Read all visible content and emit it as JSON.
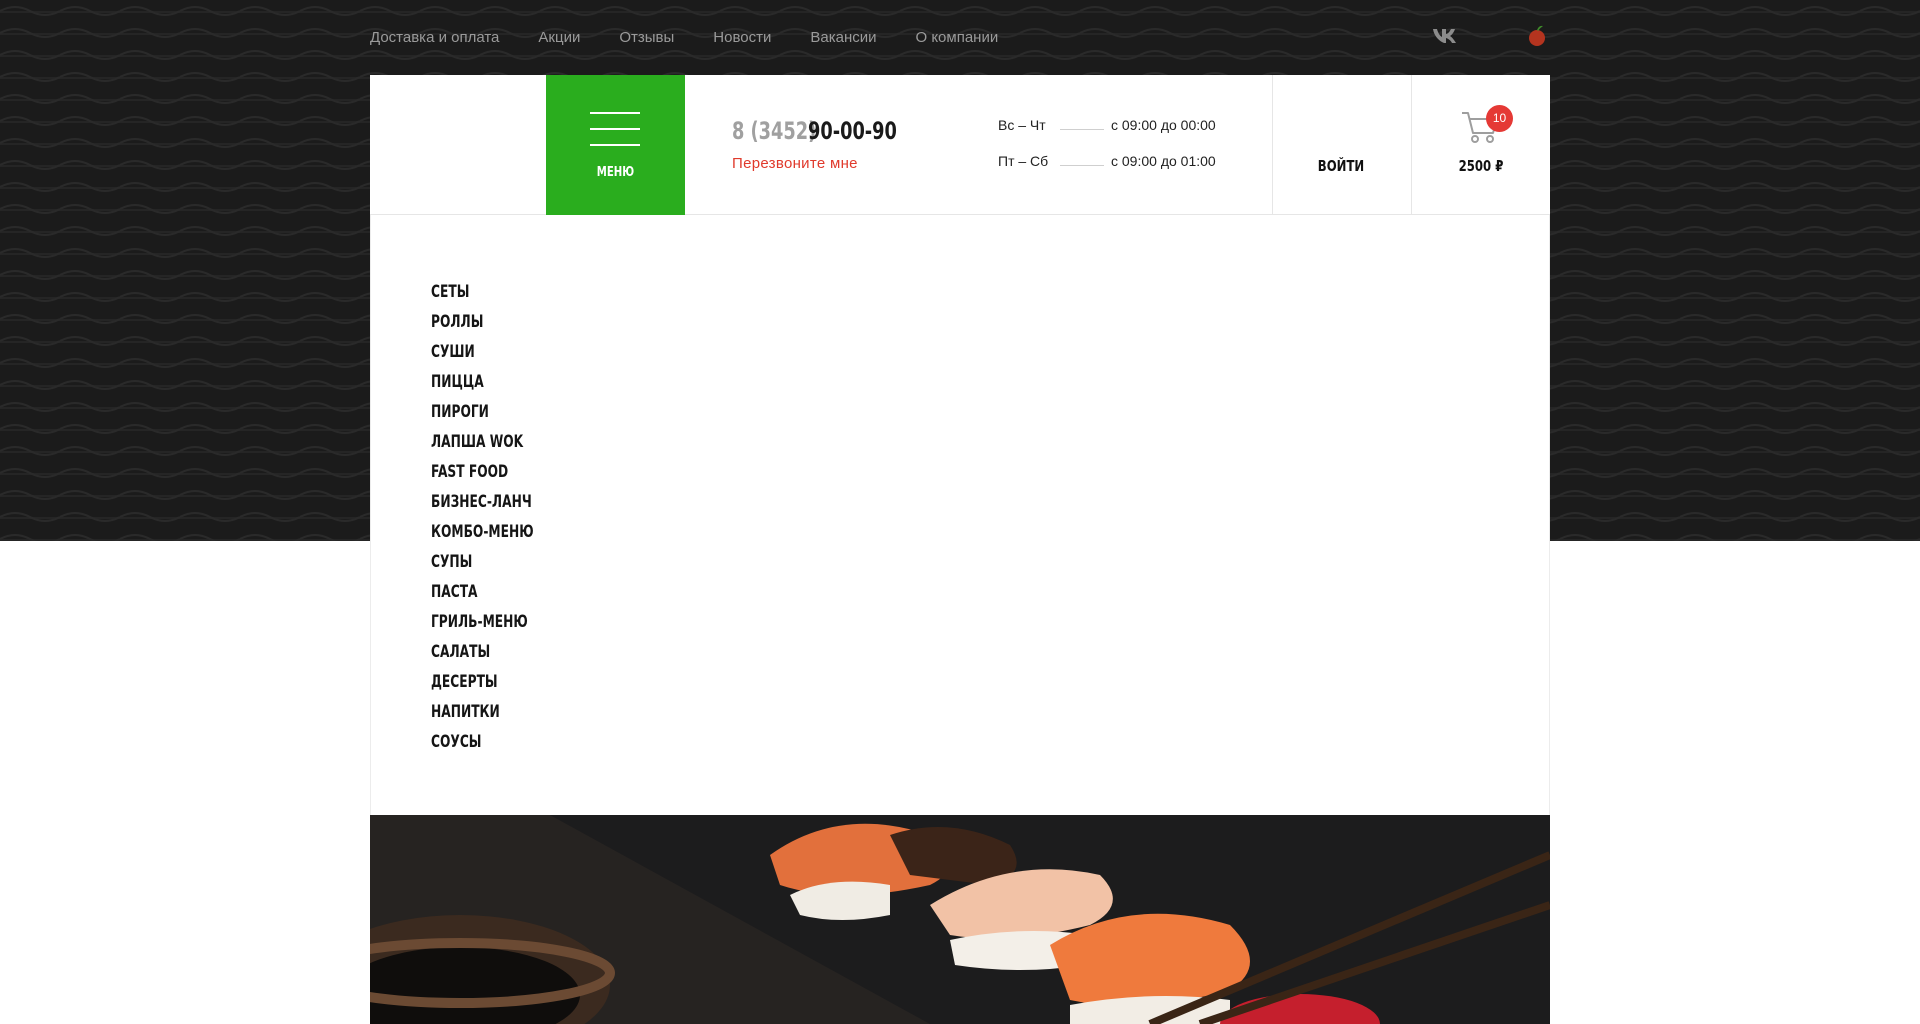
{
  "topnav": {
    "links": [
      "Доставка и оплата",
      "Акции",
      "Отзывы",
      "Новости",
      "Вакансии",
      "О компании"
    ],
    "social_icon": "vk-icon",
    "brand_icon": "apple-icon"
  },
  "header": {
    "menu_label": "МЕНЮ",
    "phone_code": "8 (3452)",
    "phone_number": "90-00-90",
    "callback_label": "Перезвоните мне",
    "hours": [
      {
        "days": "Вс – Чт",
        "time": "с 09:00 до 00:00"
      },
      {
        "days": "Пт – Сб",
        "time": "с 09:00 до 01:00"
      }
    ],
    "login_label": "ВОЙТИ",
    "cart_count": "10",
    "cart_total": "2500 ₽"
  },
  "menu": {
    "items": [
      "СЕТЫ",
      "РОЛЛЫ",
      "СУШИ",
      "ПИЦЦА",
      "ПИРОГИ",
      "ЛАПША WOK",
      "FAST FOOD",
      "БИЗНЕС-ЛАНЧ",
      "КОМБО-МЕНЮ",
      "СУПЫ",
      "ПАСТА",
      "ГРИЛЬ-МЕНЮ",
      "САЛАТЫ",
      "ДЕСЕРТЫ",
      "НАПИТКИ",
      "СОУСЫ"
    ]
  },
  "colors": {
    "accent_green": "#2aad1e",
    "callback_red": "#e03a2c",
    "badge_red": "#e53935",
    "backdrop": "#1b1b1b"
  }
}
